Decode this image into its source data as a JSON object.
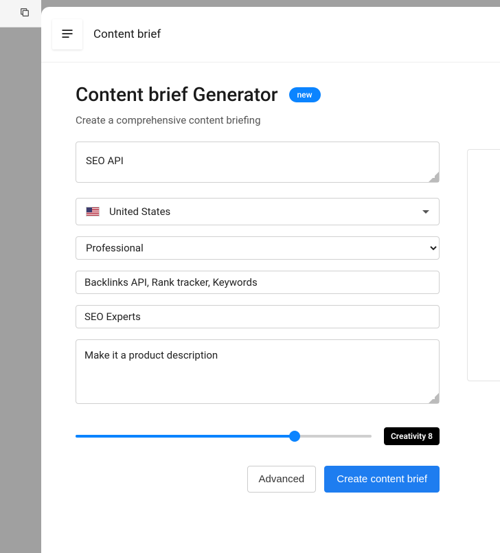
{
  "header": {
    "title": "Content brief"
  },
  "page": {
    "title": "Content brief Generator",
    "badge": "new",
    "subtitle": "Create a comprehensive content briefing"
  },
  "form": {
    "keyword": "SEO API",
    "country": "United States",
    "tone": "Professional",
    "related": "Backlinks API, Rank tracker, Keywords",
    "audience": "SEO Experts",
    "extra": "Make it a product description"
  },
  "slider": {
    "label": "Creativity 8",
    "value": 8,
    "max": 12
  },
  "buttons": {
    "advanced": "Advanced",
    "create": "Create content brief"
  }
}
